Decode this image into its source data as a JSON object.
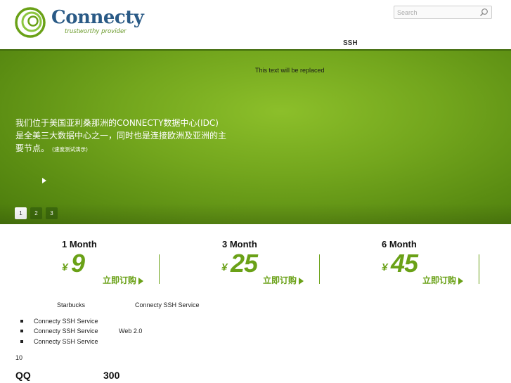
{
  "header": {
    "logo_name": "Connecty",
    "logo_tagline": "trustworthy provider",
    "search_placeholder": "Search"
  },
  "nav": {
    "ssh_label": "SSH"
  },
  "banner": {
    "placeholder_text": "This text will be replaced",
    "line1": "我们位于美国亚利桑那洲的CONNECTY数据中心(IDC)",
    "line2": "是全美三大数据中心之一，同时也是连接欧洲及亚洲的主",
    "line3": "要节点。",
    "line3_small": "(速度测试演示)",
    "pages": [
      "1",
      "2",
      "3"
    ],
    "active_page": "1"
  },
  "plans": [
    {
      "title": "1 Month",
      "currency": "¥",
      "price": "9",
      "order_label": "立即订购"
    },
    {
      "title": "3 Month",
      "currency": "¥",
      "price": "25",
      "order_label": "立即订购"
    },
    {
      "title": "6 Month",
      "currency": "¥",
      "price": "45",
      "order_label": "立即订购"
    }
  ],
  "lower": {
    "col_a": "Starbucks",
    "col_b": "Connecty SSH Service",
    "list": [
      "Connecty SSH Service",
      "Connecty SSH Service",
      "Connecty SSH Service"
    ],
    "side_label": "Web 2.0",
    "number": "10",
    "qq_label": "QQ",
    "qq_value": "300"
  },
  "colors": {
    "brand_blue": "#2a5a86",
    "brand_green": "#6aa117",
    "banner_green": "#73a61d"
  }
}
